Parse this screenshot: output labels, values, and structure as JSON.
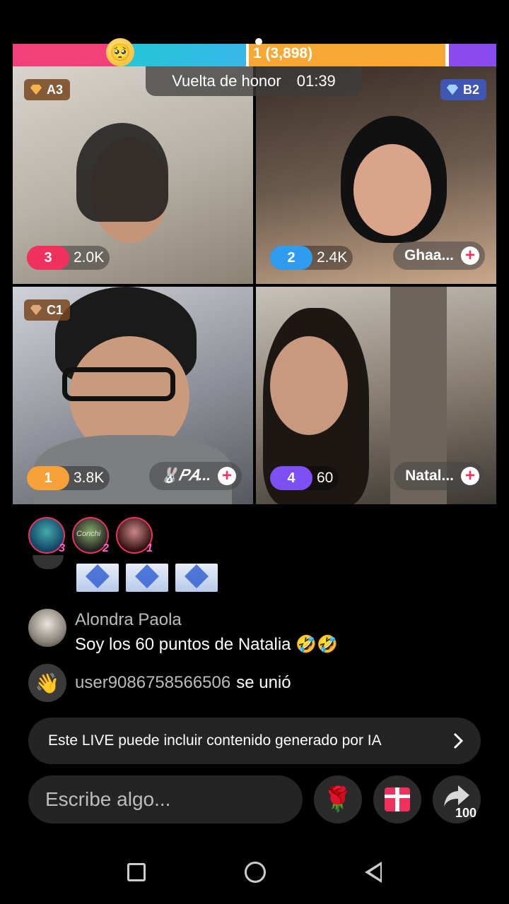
{
  "battle": {
    "rank_label": "1",
    "points_label": "(3,898)",
    "timer_label": "Vuelta de honor",
    "timer_value": "01:39"
  },
  "tiles": [
    {
      "team": "A3",
      "rank": "3",
      "score": "2.0K",
      "name": ""
    },
    {
      "team": "B2",
      "rank": "2",
      "score": "2.4K",
      "name": "Ghaa..."
    },
    {
      "team": "C1",
      "rank": "1",
      "score": "3.8K",
      "name": "🐰𝑃𝐴..."
    },
    {
      "team": "",
      "rank": "4",
      "score": "60",
      "name": "Natal..."
    }
  ],
  "viewers": [
    {
      "rank": "3"
    },
    {
      "rank": "2",
      "label": "Conchi"
    },
    {
      "rank": "1"
    }
  ],
  "comment": {
    "user": "Alondra Paola",
    "text": "Soy los 60 puntos de Natalia 🤣🤣"
  },
  "joined": {
    "user": "user9086758566506",
    "text": "se unió"
  },
  "ai_notice": "Este LIVE puede incluir contenido generado por IA",
  "input": {
    "placeholder": "Escribe algo..."
  },
  "share_count": "100",
  "colors": {
    "pink": "#f2407a",
    "cyan": "#23c6d6",
    "orange": "#f6a832",
    "purple": "#8a4cf0"
  },
  "icons": [
    "emoji-face-icon",
    "diamond-icon",
    "plus-icon",
    "rose-icon",
    "gift-icon",
    "share-icon",
    "wave-icon",
    "chevron-right-icon"
  ]
}
